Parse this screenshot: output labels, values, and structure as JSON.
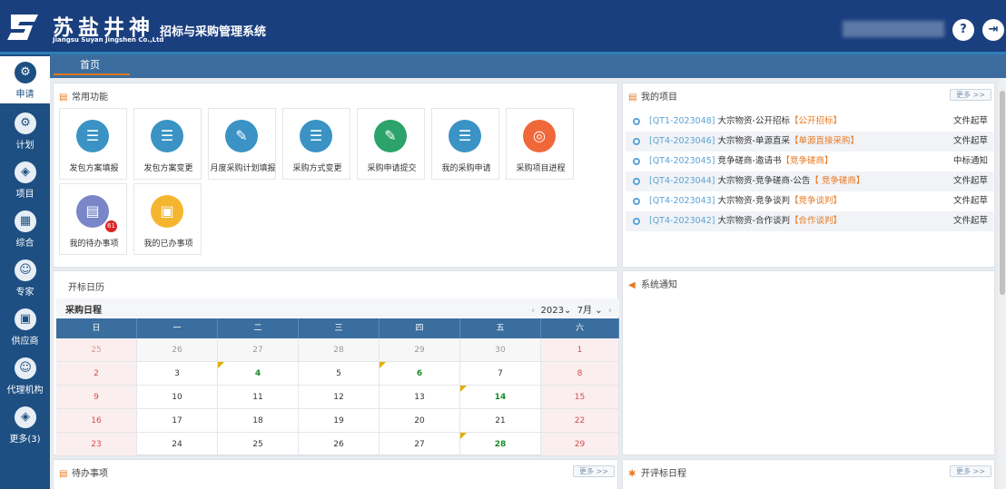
{
  "header": {
    "logo_cn": "苏盐井神",
    "logo_en": "Jiangsu Suyan Jingshen Co.,Ltd",
    "system_title": "招标与采购管理系统",
    "help_icon": "?",
    "logout_icon": "⇥"
  },
  "sidebar": {
    "items": [
      {
        "label": "申请",
        "icon": "gear-icon",
        "glyph": "⚙"
      },
      {
        "label": "计划",
        "icon": "gear-icon",
        "glyph": "⚙"
      },
      {
        "label": "项目",
        "icon": "layers-icon",
        "glyph": "◈"
      },
      {
        "label": "综合",
        "icon": "grid-icon",
        "glyph": "▦"
      },
      {
        "label": "专家",
        "icon": "users-icon",
        "glyph": "☺"
      },
      {
        "label": "供应商",
        "icon": "monitor-icon",
        "glyph": "▣"
      },
      {
        "label": "代理机构",
        "icon": "users-icon",
        "glyph": "☺"
      },
      {
        "label": "更多(3)",
        "icon": "layers-icon",
        "glyph": "◈"
      }
    ]
  },
  "tabs": {
    "home": "首页"
  },
  "common": {
    "title": "常用功能",
    "items": [
      {
        "label": "发包方案填报",
        "color": "#3a93c4",
        "glyph": "☰"
      },
      {
        "label": "发包方案变更",
        "color": "#3a93c4",
        "glyph": "☰"
      },
      {
        "label": "月度采购计划填报",
        "color": "#3a93c4",
        "glyph": "✎"
      },
      {
        "label": "采购方式变更",
        "color": "#3a93c4",
        "glyph": "☰"
      },
      {
        "label": "采购申请提交",
        "color": "#2ba36b",
        "glyph": "✎"
      },
      {
        "label": "我的采购申请",
        "color": "#3a93c4",
        "glyph": "☰"
      },
      {
        "label": "采购项目进程",
        "color": "#f0683a",
        "glyph": "◎"
      },
      {
        "label": "我的待办事项",
        "color": "#7987c9",
        "glyph": "▤",
        "badge": "61"
      },
      {
        "label": "我的已办事项",
        "color": "#f5b62f",
        "glyph": "▣"
      }
    ]
  },
  "projects": {
    "title": "我的项目",
    "more": "更多 >>",
    "rows": [
      {
        "code": "[QT1-2023048]",
        "name": "大宗物资-公开招标",
        "tag": "【公开招标】",
        "status": "文件起草"
      },
      {
        "code": "[QT4-2023046]",
        "name": "大宗物资-单源直采",
        "tag": "【单源直接采购】",
        "status": "文件起草"
      },
      {
        "code": "[QT4-2023045]",
        "name": "竞争磋商-邀请书",
        "tag": "【竞争磋商】",
        "status": "中标通知"
      },
      {
        "code": "[QT4-2023044]",
        "name": "大宗物资-竞争磋商-公告",
        "tag": "【 竞争磋商】",
        "status": "文件起草"
      },
      {
        "code": "[QT4-2023043]",
        "name": "大宗物资-竞争谈判",
        "tag": "【竞争谈判】",
        "status": "文件起草"
      },
      {
        "code": "[QT4-2023042]",
        "name": "大宗物资-合作谈判",
        "tag": "【合作谈判】",
        "status": "文件起草"
      }
    ]
  },
  "calendar_panel": {
    "tab": "开标日历",
    "title": "采购日程",
    "prev": "‹",
    "year": "2023",
    "month": "7月",
    "next": "›",
    "weekdays": [
      "日",
      "一",
      "二",
      "三",
      "四",
      "五",
      "六"
    ],
    "rows": [
      [
        {
          "d": "25",
          "prev": true
        },
        {
          "d": "26",
          "prev": true
        },
        {
          "d": "27",
          "prev": true
        },
        {
          "d": "28",
          "prev": true
        },
        {
          "d": "29",
          "prev": true
        },
        {
          "d": "30",
          "prev": true
        },
        {
          "d": "1"
        }
      ],
      [
        {
          "d": "2"
        },
        {
          "d": "3"
        },
        {
          "d": "4",
          "mark": true
        },
        {
          "d": "5"
        },
        {
          "d": "6",
          "mark": true
        },
        {
          "d": "7"
        },
        {
          "d": "8"
        }
      ],
      [
        {
          "d": "9"
        },
        {
          "d": "10"
        },
        {
          "d": "11"
        },
        {
          "d": "12"
        },
        {
          "d": "13"
        },
        {
          "d": "14",
          "mark": true
        },
        {
          "d": "15"
        }
      ],
      [
        {
          "d": "16"
        },
        {
          "d": "17"
        },
        {
          "d": "18"
        },
        {
          "d": "19"
        },
        {
          "d": "20"
        },
        {
          "d": "21"
        },
        {
          "d": "22"
        }
      ],
      [
        {
          "d": "23"
        },
        {
          "d": "24"
        },
        {
          "d": "25"
        },
        {
          "d": "26"
        },
        {
          "d": "27"
        },
        {
          "d": "28",
          "mark": true
        },
        {
          "d": "29"
        }
      ]
    ]
  },
  "notice": {
    "title": "系统通知"
  },
  "todo": {
    "title": "待办事项",
    "more": "更多 >>"
  },
  "bid_schedule": {
    "title": "开评标日程",
    "more": "更多 >>"
  }
}
